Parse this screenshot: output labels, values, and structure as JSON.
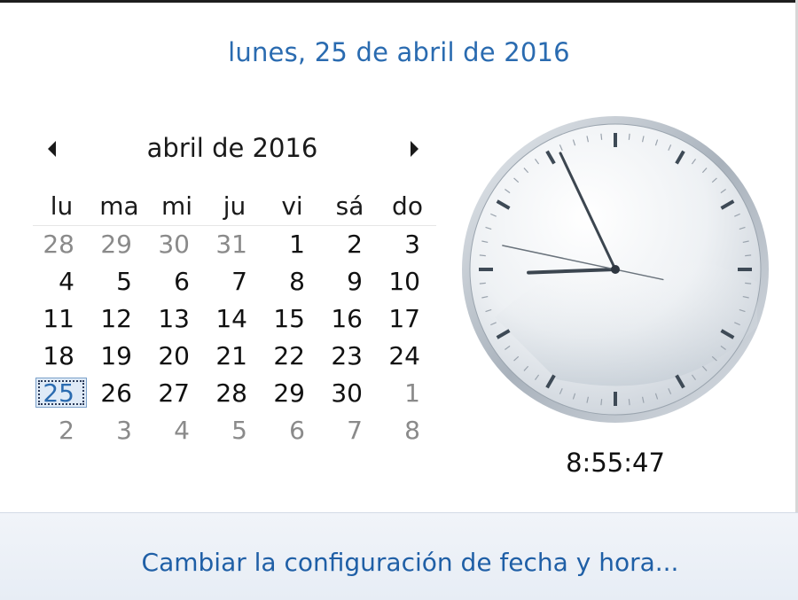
{
  "header": {
    "long_date": "lunes, 25 de abril de 2016"
  },
  "calendar": {
    "month_label": "abril de 2016",
    "prev_month_icon": "triangle-left-icon",
    "next_month_icon": "triangle-right-icon",
    "weekdays": [
      "lu",
      "ma",
      "mi",
      "ju",
      "vi",
      "sá",
      "do"
    ],
    "days": [
      {
        "label": "28",
        "state": "other"
      },
      {
        "label": "29",
        "state": "other"
      },
      {
        "label": "30",
        "state": "other"
      },
      {
        "label": "31",
        "state": "other"
      },
      {
        "label": "1",
        "state": "current"
      },
      {
        "label": "2",
        "state": "current"
      },
      {
        "label": "3",
        "state": "current"
      },
      {
        "label": "4",
        "state": "current"
      },
      {
        "label": "5",
        "state": "current"
      },
      {
        "label": "6",
        "state": "current"
      },
      {
        "label": "7",
        "state": "current"
      },
      {
        "label": "8",
        "state": "current"
      },
      {
        "label": "9",
        "state": "current"
      },
      {
        "label": "10",
        "state": "current"
      },
      {
        "label": "11",
        "state": "current"
      },
      {
        "label": "12",
        "state": "current"
      },
      {
        "label": "13",
        "state": "current"
      },
      {
        "label": "14",
        "state": "current"
      },
      {
        "label": "15",
        "state": "current"
      },
      {
        "label": "16",
        "state": "current"
      },
      {
        "label": "17",
        "state": "current"
      },
      {
        "label": "18",
        "state": "current"
      },
      {
        "label": "19",
        "state": "current"
      },
      {
        "label": "20",
        "state": "current"
      },
      {
        "label": "21",
        "state": "current"
      },
      {
        "label": "22",
        "state": "current"
      },
      {
        "label": "23",
        "state": "current"
      },
      {
        "label": "24",
        "state": "current"
      },
      {
        "label": "25",
        "state": "today"
      },
      {
        "label": "26",
        "state": "current"
      },
      {
        "label": "27",
        "state": "current"
      },
      {
        "label": "28",
        "state": "current"
      },
      {
        "label": "29",
        "state": "current"
      },
      {
        "label": "30",
        "state": "current"
      },
      {
        "label": "1",
        "state": "other"
      },
      {
        "label": "2",
        "state": "other"
      },
      {
        "label": "3",
        "state": "other"
      },
      {
        "label": "4",
        "state": "other"
      },
      {
        "label": "5",
        "state": "other"
      },
      {
        "label": "6",
        "state": "other"
      },
      {
        "label": "7",
        "state": "other"
      },
      {
        "label": "8",
        "state": "other"
      }
    ]
  },
  "clock": {
    "time": {
      "hours": 8,
      "minutes": 55,
      "seconds": 47
    },
    "digital_time": "8:55:47"
  },
  "footer": {
    "link_label": "Cambiar la configuración de fecha y hora..."
  },
  "colors": {
    "header_text": "#2a6bb0",
    "link_text": "#1f5fa6",
    "other_month_day": "#8a8a8a",
    "today_highlight": "#dfeaf7"
  }
}
